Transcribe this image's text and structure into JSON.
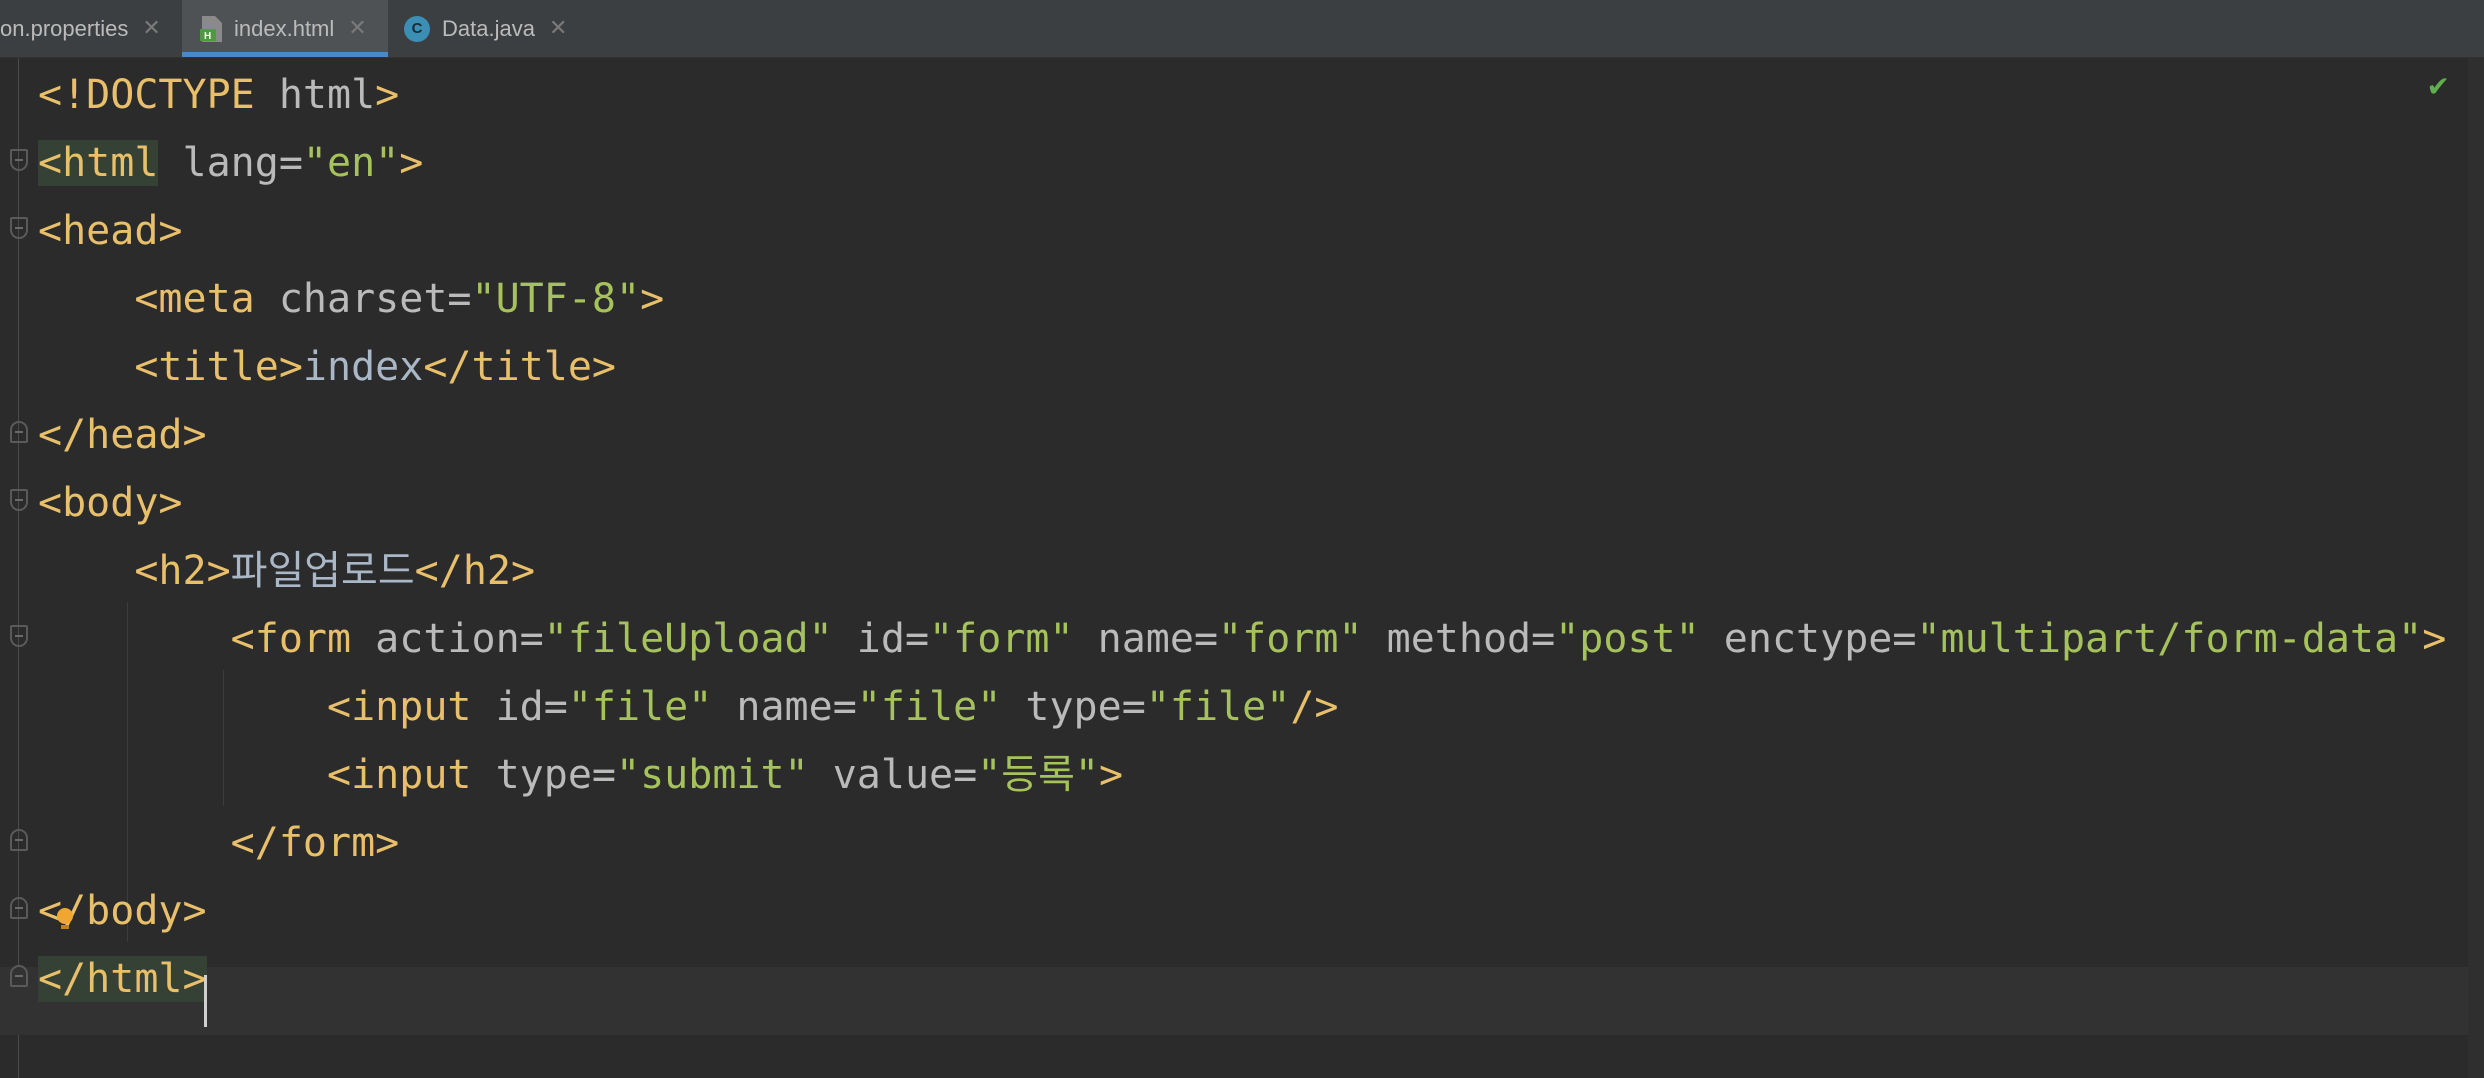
{
  "tabs": [
    {
      "label": "on.properties",
      "close": "✕",
      "active": false
    },
    {
      "label": "index.html",
      "close": "✕",
      "active": true
    },
    {
      "label": "Data.java",
      "close": "✕",
      "active": false,
      "icon_letter": "C"
    }
  ],
  "editor": {
    "status_icon": "✔",
    "lines": [
      {
        "tokens": [
          [
            "tag",
            "<!DOCTYPE "
          ],
          [
            "attr",
            "html"
          ],
          [
            "tag",
            ">"
          ]
        ]
      },
      {
        "tokens": [
          [
            "tag hl",
            "<html"
          ],
          [
            "attr",
            " lang="
          ],
          [
            "val",
            "\"en\""
          ],
          [
            "tag",
            ">"
          ]
        ]
      },
      {
        "tokens": [
          [
            "tag",
            "<head>"
          ]
        ]
      },
      {
        "tokens": [
          [
            "txt",
            "    "
          ],
          [
            "tag",
            "<meta"
          ],
          [
            "attr",
            " charset="
          ],
          [
            "val",
            "\"UTF-8\""
          ],
          [
            "tag",
            ">"
          ]
        ]
      },
      {
        "tokens": [
          [
            "txt",
            "    "
          ],
          [
            "tag",
            "<title>"
          ],
          [
            "txt",
            "index"
          ],
          [
            "tag",
            "</title>"
          ]
        ]
      },
      {
        "tokens": [
          [
            "tag",
            "</head>"
          ]
        ]
      },
      {
        "tokens": [
          [
            "tag",
            "<body>"
          ]
        ]
      },
      {
        "tokens": [
          [
            "txt",
            "    "
          ],
          [
            "tag",
            "<h2>"
          ],
          [
            "txt",
            "파일업로드"
          ],
          [
            "tag",
            "</h2>"
          ]
        ]
      },
      {
        "tokens": [
          [
            "txt",
            "        "
          ],
          [
            "tag",
            "<form"
          ],
          [
            "attr",
            " action="
          ],
          [
            "val",
            "\"fileUpload\""
          ],
          [
            "attr",
            " id="
          ],
          [
            "val",
            "\"form\""
          ],
          [
            "attr",
            " name="
          ],
          [
            "val",
            "\"form\""
          ],
          [
            "attr",
            " method="
          ],
          [
            "val",
            "\"post\""
          ],
          [
            "attr",
            " enctype="
          ],
          [
            "val",
            "\"multipart/form-data\""
          ],
          [
            "tag",
            ">"
          ]
        ]
      },
      {
        "tokens": [
          [
            "txt",
            "            "
          ],
          [
            "tag",
            "<input"
          ],
          [
            "attr",
            " id="
          ],
          [
            "val",
            "\"file\""
          ],
          [
            "attr",
            " name="
          ],
          [
            "val",
            "\"file\""
          ],
          [
            "attr",
            " type="
          ],
          [
            "val",
            "\"file\""
          ],
          [
            "tag",
            "/>"
          ]
        ]
      },
      {
        "tokens": [
          [
            "txt",
            "            "
          ],
          [
            "tag",
            "<input"
          ],
          [
            "attr",
            " type="
          ],
          [
            "val",
            "\"submit\""
          ],
          [
            "attr",
            " value="
          ],
          [
            "val",
            "\"등록\""
          ],
          [
            "tag",
            ">"
          ]
        ]
      },
      {
        "tokens": [
          [
            "txt",
            "        "
          ],
          [
            "tag",
            "</form>"
          ]
        ]
      },
      {
        "tokens": [
          [
            "tag",
            "</body>"
          ]
        ]
      },
      {
        "tokens": [
          [
            "tag hl",
            "</html>"
          ]
        ]
      }
    ]
  },
  "colors": {
    "background": "#2b2b2b",
    "tag": "#e8bf6a",
    "attribute": "#bababa",
    "value": "#a5c25c",
    "text": "#a9b7c6",
    "tab_accent": "#4a88c7"
  }
}
